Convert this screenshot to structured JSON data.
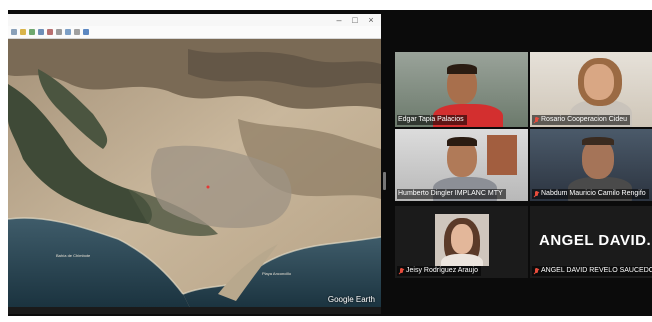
{
  "map_window": {
    "title_buttons": [
      "–",
      "□",
      "×"
    ],
    "labels": [
      {
        "key": "bay",
        "text": "Bahía de Chimbote"
      },
      {
        "key": "beach",
        "text": "Playa Anconcillo"
      }
    ],
    "attribution": "Google Earth"
  },
  "participants": [
    {
      "name": "Edgar Tapia Palacios",
      "muted": false,
      "active": true
    },
    {
      "name": "Rosario Cooperacion Cideu",
      "muted": true,
      "active": false
    },
    {
      "name": "Humberto Dingler IMPLANC MTY",
      "muted": false,
      "active": false
    },
    {
      "name": "Nabdum Mauricio Camilo Rengifo",
      "muted": true,
      "active": false
    },
    {
      "name": "Jeisy Rodríguez Araujo",
      "muted": true,
      "active": false
    },
    {
      "name": "ANGEL DAVID REVELO SAUCEDO",
      "muted": true,
      "active": false,
      "display_text": "ANGEL  DAVID..."
    }
  ],
  "colors": {
    "active_speaker_border": "#2e9f4f",
    "muted_mic": "#e74c3c",
    "gallery_background": "#0b0b0b"
  }
}
